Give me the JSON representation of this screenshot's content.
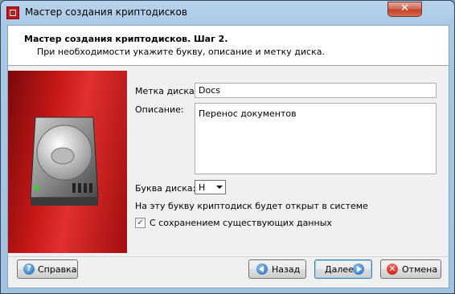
{
  "window": {
    "title": "Мастер создания криптодисков"
  },
  "header": {
    "title": "Мастер создания криптодисков. Шаг 2.",
    "subtitle": "При необходимости укажите букву, описание и метку диска."
  },
  "form": {
    "label_label": "Метка диска:",
    "label_value": "Docs",
    "description_label": "Описание:",
    "description_value": "Перенос документов",
    "letter_label": "Буква диска:",
    "letter_value": "H",
    "hint": "На эту букву криптодиск будет открыт в системе",
    "keep_data_label": "С сохранением существующих данных",
    "keep_data_checked": true
  },
  "buttons": {
    "help": "Справка",
    "back": "Назад",
    "next": "Далее",
    "cancel": "Отмена",
    "close_glyph": "✕",
    "help_icon": "question-icon",
    "back_icon": "arrow-left-icon",
    "next_icon": "arrow-right-icon",
    "cancel_icon": "red-x-icon"
  },
  "colors": {
    "accent_red": "#c81818",
    "window_blue": "#a9c8e6"
  }
}
